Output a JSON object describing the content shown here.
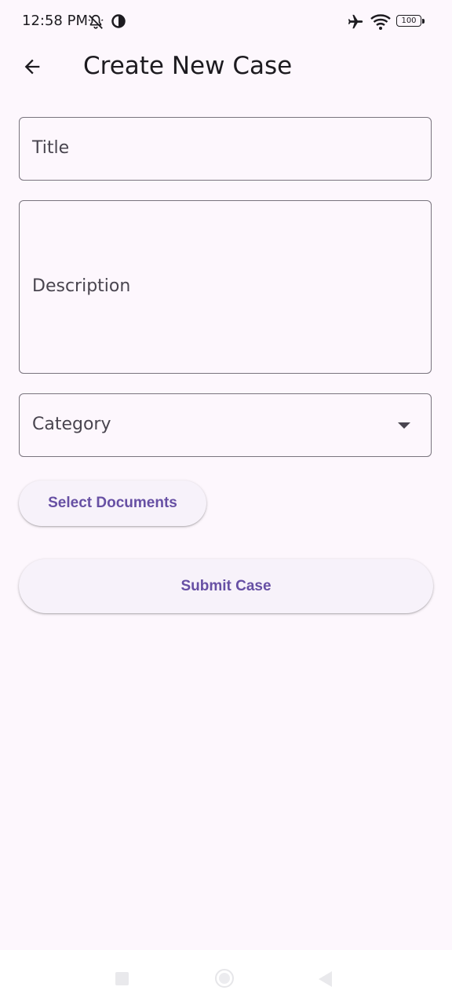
{
  "status_bar": {
    "time": "12:58 PM",
    "battery": "100",
    "icons": [
      "mute-icon",
      "data-saver-icon",
      "airplane-icon",
      "wifi-icon",
      "battery-icon"
    ]
  },
  "app_bar": {
    "title": "Create New Case",
    "back_icon": "arrow-back-icon"
  },
  "form": {
    "title_label": "Title",
    "description_label": "Description",
    "category_label": "Category",
    "category_icon": "dropdown-arrow-icon"
  },
  "buttons": {
    "select_documents": "Select Documents",
    "submit_case": "Submit Case"
  },
  "colors": {
    "background": "#fdf7fd",
    "accent": "#6750a4",
    "outline": "#79747e",
    "button_bg": "#f7f2fa"
  }
}
